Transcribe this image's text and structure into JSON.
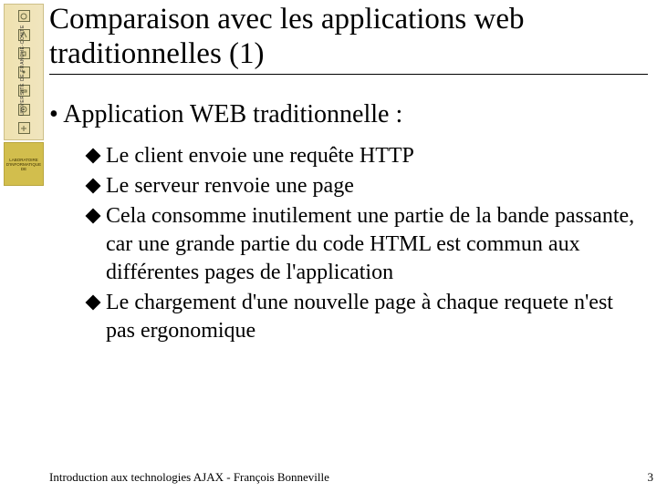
{
  "logo": {
    "vertical_text": "UNIVERSITE DE FRANCHE-COMTE",
    "bottom_text": "LABORATOIRE D'INFORMATIQUE DE"
  },
  "title": "Comparaison avec les applications web traditionnelles (1)",
  "body": {
    "main_bullet": "Application WEB traditionnelle :",
    "sub_bullets": [
      "Le client envoie une requête HTTP",
      "Le serveur renvoie une page",
      "Cela consomme inutilement une partie de la bande passante, car une grande partie du code HTML est commun aux différentes pages de l'application",
      "Le chargement d'une nouvelle page à chaque requete n'est pas ergonomique"
    ]
  },
  "footer": "Introduction aux technologies AJAX - François Bonneville",
  "page_number": "3"
}
